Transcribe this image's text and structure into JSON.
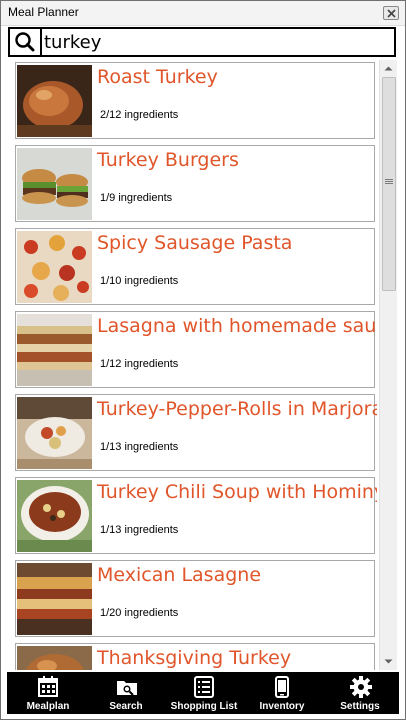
{
  "window": {
    "title": "Meal Planner"
  },
  "search": {
    "value": "turkey"
  },
  "recipes": [
    {
      "title": "Roast Turkey",
      "ingredients": "2/12 ingredients"
    },
    {
      "title": "Turkey Burgers",
      "ingredients": "1/9 ingredients"
    },
    {
      "title": "Spicy Sausage Pasta",
      "ingredients": "1/10 ingredients"
    },
    {
      "title": "Lasagna with homemade sauce",
      "ingredients": "1/12 ingredients"
    },
    {
      "title": "Turkey-Pepper-Rolls in Marjoram",
      "ingredients": "1/13 ingredients"
    },
    {
      "title": "Turkey Chili Soup with Hominy",
      "ingredients": "1/13 ingredients"
    },
    {
      "title": "Mexican Lasagne",
      "ingredients": "1/20 ingredients"
    },
    {
      "title": "Thanksgiving Turkey",
      "ingredients": ""
    }
  ],
  "nav": [
    {
      "label": "Mealplan",
      "icon": "calendar-icon"
    },
    {
      "label": "Search",
      "icon": "search-folder-icon"
    },
    {
      "label": "Shopping List",
      "icon": "list-icon"
    },
    {
      "label": "Inventory",
      "icon": "phone-icon"
    },
    {
      "label": "Settings",
      "icon": "gear-icon"
    }
  ],
  "colors": {
    "title_accent": "#e0552a",
    "nav_bg": "#000000"
  }
}
